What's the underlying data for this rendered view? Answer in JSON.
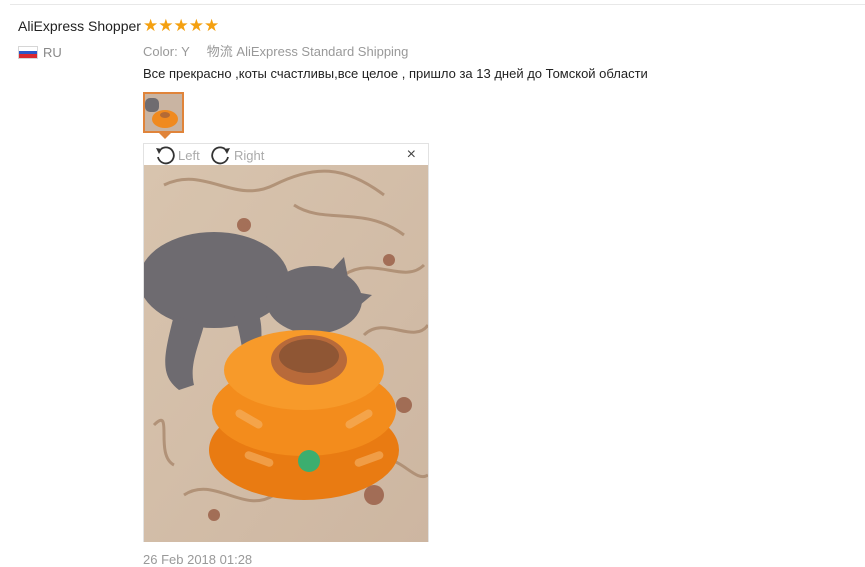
{
  "reviewer": {
    "name": "AliExpress Shopper",
    "country": "RU",
    "stars": "★★★★★",
    "rating": 5,
    "star_color": "#f4a010"
  },
  "details": {
    "color_label": "Color:",
    "color_value": "Y",
    "shipping_label": "物流",
    "shipping_value": "AliExpress Standard Shipping"
  },
  "review_text": "Все прекрасно ,коты счастливы,все целое , пришло за 13 дней до Томской области",
  "viewer": {
    "rotate_left_label": "Left",
    "rotate_right_label": "Right",
    "close_glyph": "×",
    "thumb_border_color": "#e0843a"
  },
  "date": "26 Feb 2018 01:28",
  "icons": [
    "russia-flag-icon",
    "star-icon",
    "rotate-left-icon",
    "rotate-right-icon",
    "close-icon"
  ]
}
